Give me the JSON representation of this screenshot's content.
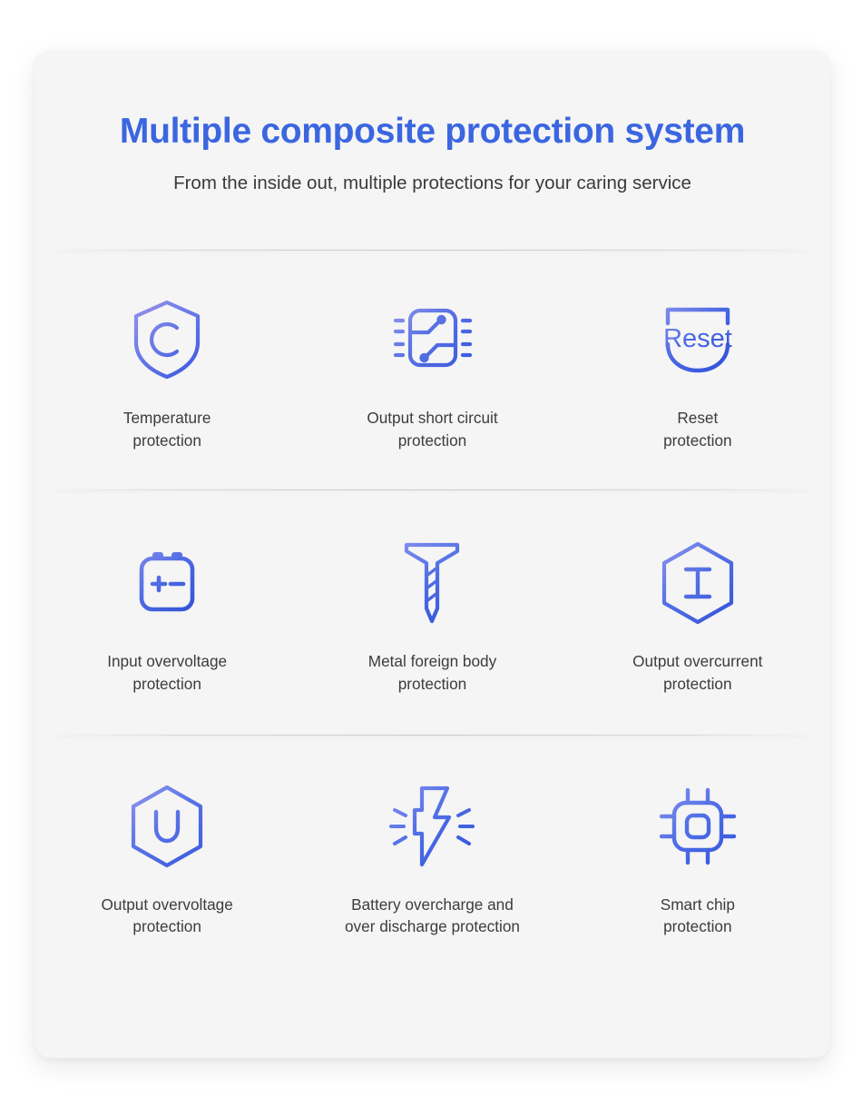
{
  "header": {
    "title": "Multiple composite protection system",
    "subtitle": "From the inside out, multiple protections for your caring service"
  },
  "colors": {
    "title_blue": "#3b66e0",
    "icon_gradient_start": "#8f8ee8",
    "icon_gradient_end": "#3858e0",
    "card_background": "#f5f5f5",
    "page_background": "#ffffff",
    "label_text": "#3c3c3c"
  },
  "icon_text": {
    "temperature": "C",
    "reset": "Reset",
    "overcurrent": "I",
    "overvoltage": "U",
    "battery_plus": "+",
    "battery_minus": "−"
  },
  "rows": [
    {
      "cells": [
        {
          "icon": "shield-c-icon",
          "label": "Temperature\nprotection"
        },
        {
          "icon": "chip-short-circuit-icon",
          "label": "Output short circuit\nprotection"
        },
        {
          "icon": "reset-shield-icon",
          "label": "Reset\nprotection"
        }
      ]
    },
    {
      "cells": [
        {
          "icon": "battery-icon",
          "label": "Input overvoltage\nprotection"
        },
        {
          "icon": "screw-nail-icon",
          "label": "Metal foreign body\nprotection"
        },
        {
          "icon": "hexagon-i-icon",
          "label": "Output overcurrent\nprotection"
        }
      ]
    },
    {
      "cells": [
        {
          "icon": "hexagon-u-icon",
          "label": "Output overvoltage\nprotection"
        },
        {
          "icon": "lightning-bolt-icon",
          "label": "Battery overcharge and\nover discharge protection"
        },
        {
          "icon": "smart-chip-icon",
          "label": "Smart chip\nprotection"
        }
      ]
    }
  ]
}
